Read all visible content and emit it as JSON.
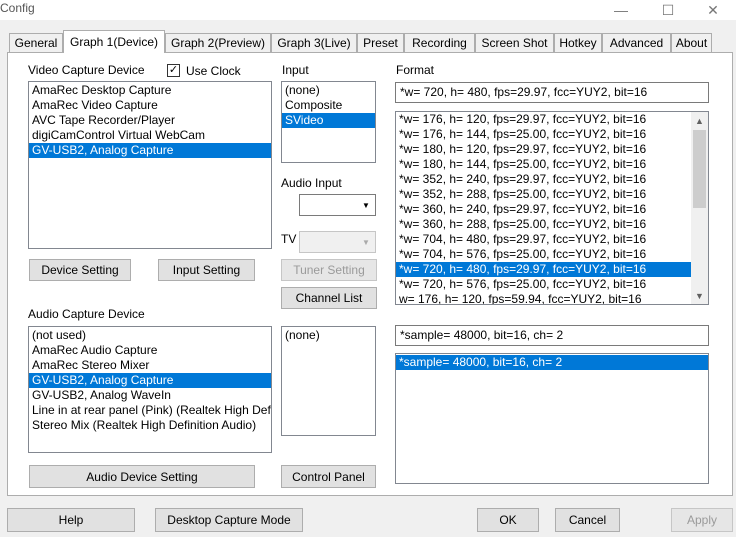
{
  "window": {
    "title": "Config",
    "minimize_glyph": "—",
    "maximize_glyph": "☐",
    "close_glyph": "✕"
  },
  "tabs": [
    "General",
    "Graph 1(Device)",
    "Graph 2(Preview)",
    "Graph 3(Live)",
    "Preset",
    "Recording",
    "Screen Shot",
    "Hotkey",
    "Advanced",
    "About"
  ],
  "video": {
    "label": "Video Capture Device",
    "use_clock_label": "Use Clock",
    "use_clock_checked": true,
    "devices": [
      "AmaRec Desktop Capture",
      "AmaRec Video Capture",
      "AVC Tape Recorder/Player",
      "digiCamControl Virtual WebCam",
      "GV-USB2, Analog Capture"
    ],
    "device_setting": "Device Setting",
    "input_setting": "Input Setting"
  },
  "input": {
    "label": "Input",
    "items": [
      "(none)",
      "Composite",
      "SVideo"
    ],
    "audio_input_label": "Audio Input",
    "tv_label": "TV",
    "tuner_setting": "Tuner Setting",
    "channel_list": "Channel List"
  },
  "format": {
    "label": "Format",
    "current": "*w= 720, h= 480, fps=29.97,  fcc=YUY2, bit=16",
    "items": [
      "*w= 176, h= 120, fps=29.97,  fcc=YUY2, bit=16",
      "*w= 176, h= 144, fps=25.00,  fcc=YUY2, bit=16",
      "*w= 180, h= 120, fps=29.97,  fcc=YUY2, bit=16",
      "*w= 180, h= 144, fps=25.00,  fcc=YUY2, bit=16",
      "*w= 352, h= 240, fps=29.97,  fcc=YUY2, bit=16",
      "*w= 352, h= 288, fps=25.00,  fcc=YUY2, bit=16",
      "*w= 360, h= 240, fps=29.97,  fcc=YUY2, bit=16",
      "*w= 360, h= 288, fps=25.00,  fcc=YUY2, bit=16",
      "*w= 704, h= 480, fps=29.97,  fcc=YUY2, bit=16",
      "*w= 704, h= 576, fps=25.00,  fcc=YUY2, bit=16",
      "*w= 720, h= 480, fps=29.97,  fcc=YUY2, bit=16",
      "*w= 720, h= 576, fps=25.00,  fcc=YUY2, bit=16",
      "w= 176, h= 120, fps=59.94,  fcc=YUY2, bit=16"
    ]
  },
  "audio": {
    "label": "Audio Capture Device",
    "devices": [
      "(not used)",
      "AmaRec Audio Capture",
      "AmaRec Stereo Mixer",
      "GV-USB2, Analog Capture",
      "GV-USB2, Analog WaveIn",
      "Line in at rear panel (Pink) (Realtek High Definition Audio)",
      "Stereo Mix (Realtek High Definition Audio)"
    ],
    "input_items": [
      "(none)"
    ],
    "device_setting": "Audio Device Setting",
    "control_panel": "Control Panel",
    "sample_current": "*sample= 48000, bit=16, ch= 2",
    "sample_items": [
      "*sample= 48000, bit=16, ch= 2"
    ]
  },
  "footer": {
    "help": "Help",
    "desktop": "Desktop Capture Mode",
    "ok": "OK",
    "cancel": "Cancel",
    "apply": "Apply"
  }
}
